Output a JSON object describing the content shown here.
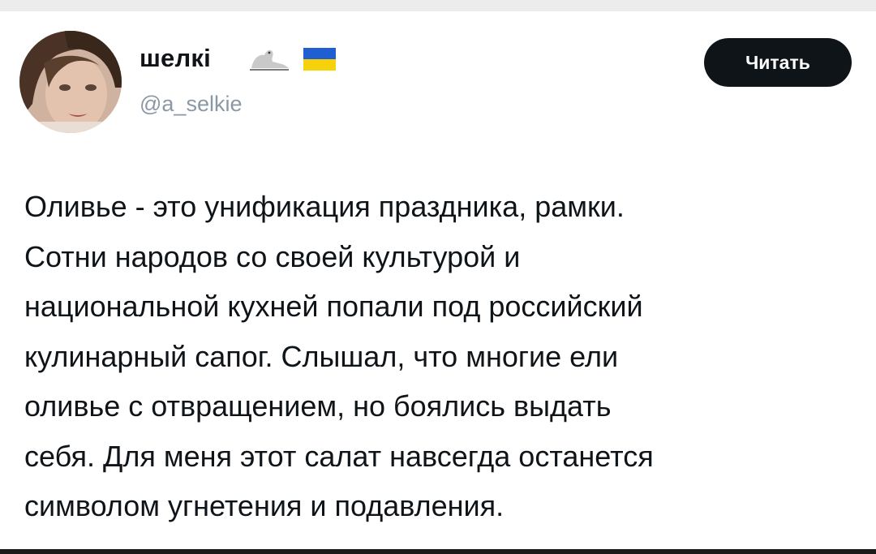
{
  "tweet": {
    "author": {
      "display_name": "шелкі",
      "handle": "@a_selkie",
      "badges": [
        "seal-icon",
        "ukraine-flag-icon"
      ]
    },
    "follow_button_label": "Читать",
    "text_lines": [
      "Оливье - это унификация праздника, рамки.",
      "Сотни народов со своей культурой и",
      "национальной кухней попали под российский",
      "кулинарный сапог. Слышал, что многие ели",
      "оливье с отвращением, но боялись выдать",
      "себя. Для меня этот салат навсегда останется",
      "символом угнетения и подавления."
    ]
  },
  "colors": {
    "button_bg": "#0f1419",
    "button_text": "#ffffff",
    "text_primary": "#0f1419",
    "text_secondary": "#8b98a5",
    "flag_blue": "#1f5fd1",
    "flag_yellow": "#f5d20a"
  }
}
